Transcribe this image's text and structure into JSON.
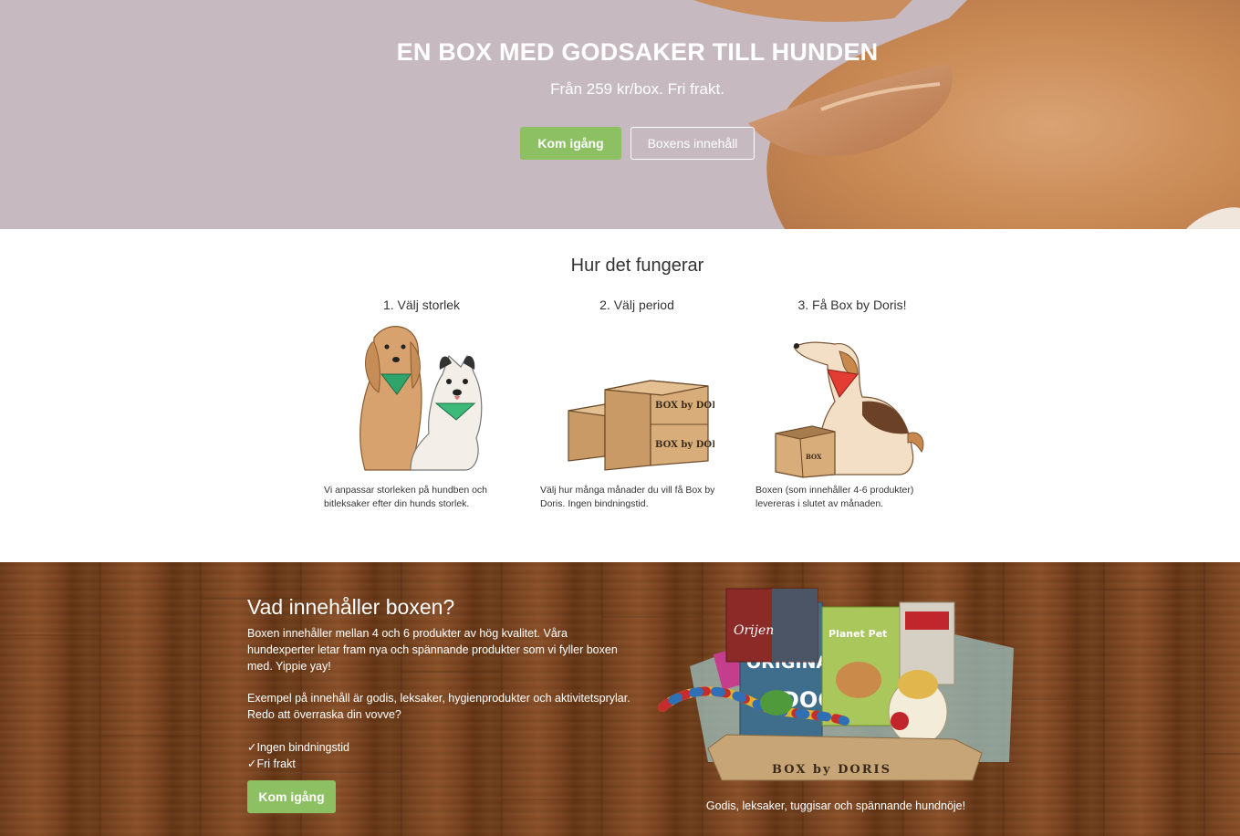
{
  "hero": {
    "title": "EN BOX MED GODSAKER TILL HUNDEN",
    "subtitle": "Från 259 kr/box. Fri frakt.",
    "primary_button": "Kom igång",
    "secondary_button": "Boxens innehåll"
  },
  "how": {
    "title": "Hur det fungerar",
    "steps": [
      {
        "title": "1. Välj storlek",
        "desc": "Vi anpassar storleken på hundben och bitleksaker efter din hunds storlek."
      },
      {
        "title": "2. Välj period",
        "desc": "Välj hur många månader du vill få Box by Doris. Ingen bindningstid."
      },
      {
        "title": "3. Få Box by Doris!",
        "desc": "Boxen (som innehåller 4-6 produkter) levereras i slutet av månaden."
      }
    ]
  },
  "contents": {
    "heading": "Vad innehåller boxen?",
    "para1": "Boxen innehåller mellan 4 och 6 produkter av hög kvalitet. Våra hundexperter letar fram nya och spännande produkter som vi fyller boxen med. Yippie yay!",
    "para2": "Exempel på innehåll är godis, leksaker, hygienprodukter och aktivitetsprylar. Redo att överraska din vovve?",
    "checks": [
      "✓Ingen bindningstid",
      "✓Fri frakt"
    ],
    "button": "Kom igång",
    "image_caption": "Godis, leksaker, tuggisar och spännande hundnöje!",
    "box_brand": "BOX by DORIS",
    "product_labels": [
      "Orijen",
      "ORIGINAL",
      "DOG",
      "Planet Pet"
    ]
  },
  "colors": {
    "accent_green": "#8dc063",
    "wood": "#7c4622"
  }
}
